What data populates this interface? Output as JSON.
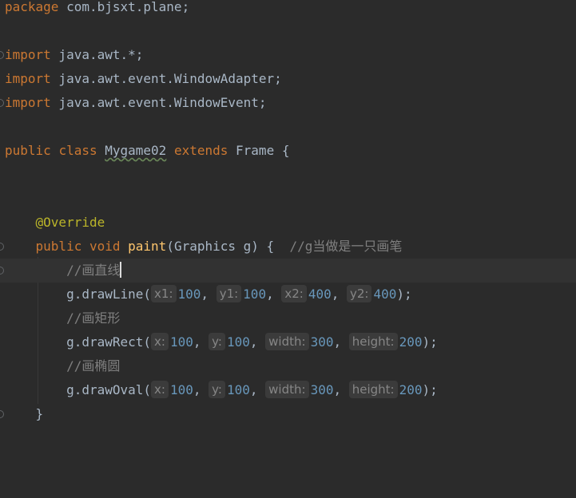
{
  "editor": {
    "package_kw": "package",
    "package_name": " com.bjsxt.plane;",
    "import_kw": "import",
    "imports": [
      " java.awt.*;",
      " java.awt.event.WindowAdapter;",
      " java.awt.event.WindowEvent;"
    ],
    "class_decl": {
      "public_kw": "public",
      "class_kw": "class",
      "class_name": "Mygame02",
      "extends_kw": "extends",
      "superclass": "Frame",
      "open_brace": " {"
    },
    "method": {
      "annotation": "@Override",
      "public_kw": "public",
      "void_kw": "void",
      "name": "paint",
      "params": "(Graphics g) {  ",
      "comment": "//g当做是一只画笔",
      "close_brace": "}"
    },
    "statements": [
      {
        "comment": "//画直线",
        "call": "g.drawLine(",
        "args": [
          {
            "hint": "x1:",
            "value": "100"
          },
          {
            "hint": "y1:",
            "value": "100"
          },
          {
            "hint": "x2:",
            "value": "400"
          },
          {
            "hint": "y2:",
            "value": "400"
          }
        ],
        "end": ");"
      },
      {
        "comment": "//画矩形",
        "call": "g.drawRect(",
        "args": [
          {
            "hint": "x:",
            "value": "100"
          },
          {
            "hint": "y:",
            "value": "100"
          },
          {
            "hint": "width:",
            "value": "300"
          },
          {
            "hint": "height:",
            "value": "200"
          }
        ],
        "end": ");"
      },
      {
        "comment": "//画椭圆",
        "call": "g.drawOval(",
        "args": [
          {
            "hint": "x:",
            "value": "100"
          },
          {
            "hint": "y:",
            "value": "100"
          },
          {
            "hint": "width:",
            "value": "300"
          },
          {
            "hint": "height:",
            "value": "200"
          }
        ],
        "end": ");"
      }
    ],
    "separator": ", "
  },
  "colors": {
    "background": "#2b2b2b",
    "current_line": "#323232",
    "keyword": "#cc7832",
    "annotation": "#bbb529",
    "method_name": "#ffc66d",
    "number": "#6897bb",
    "comment": "#808080",
    "text": "#a9b7c6"
  }
}
